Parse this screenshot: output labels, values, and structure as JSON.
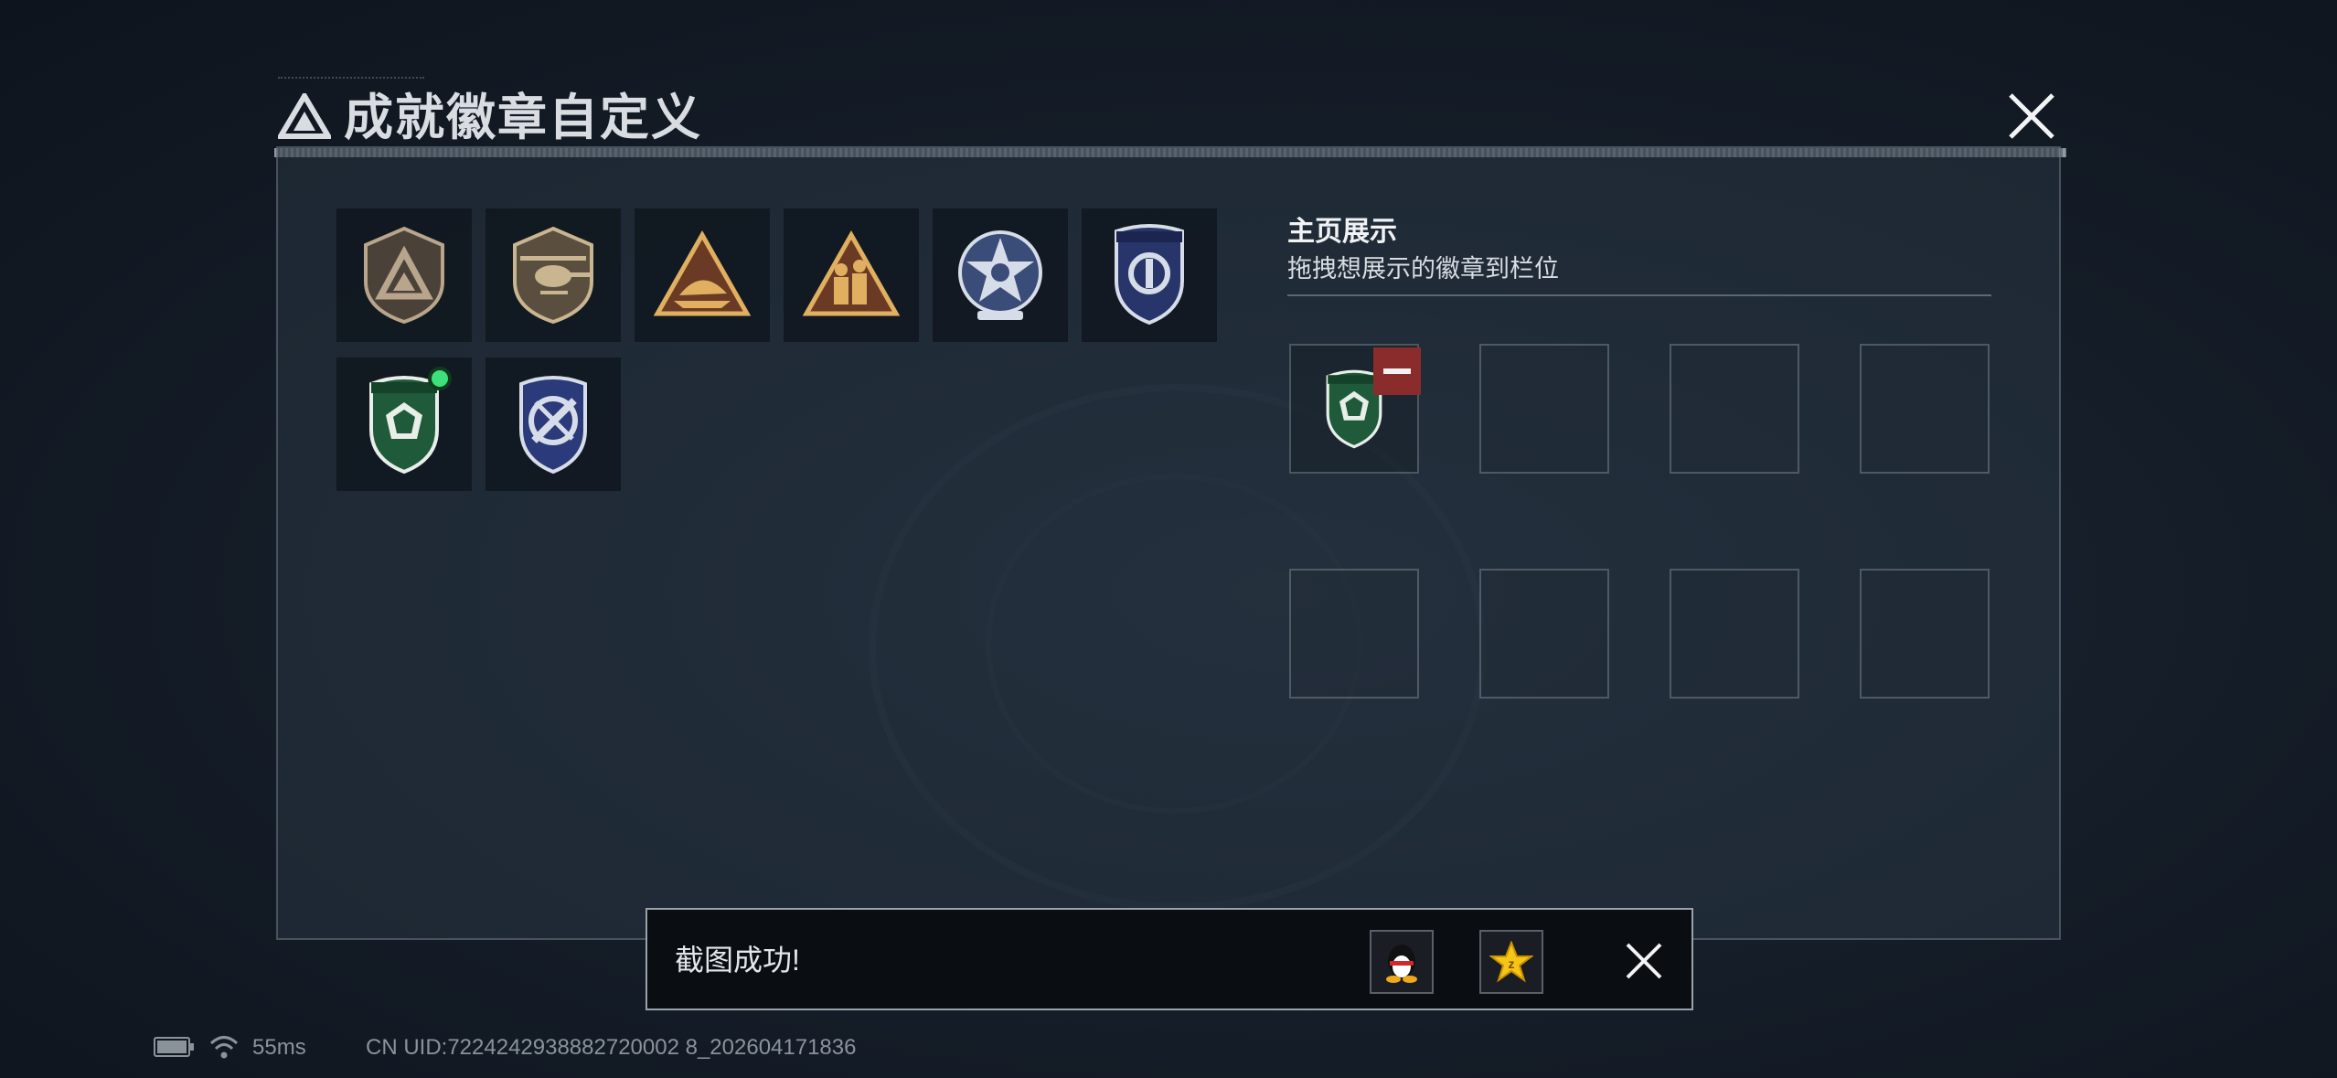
{
  "header": {
    "title": "成就徽章自定义",
    "logo_icon": "triangle-logo-icon",
    "close_icon": "close-icon"
  },
  "badges": [
    {
      "id": "badge-1",
      "icon": "triangle-shield-badge-icon",
      "colors": [
        "#4a4238",
        "#b8a58c"
      ]
    },
    {
      "id": "badge-2",
      "icon": "helicopter-badge-icon",
      "colors": [
        "#5a4f3f",
        "#c9b590"
      ]
    },
    {
      "id": "badge-3",
      "icon": "sailing-ship-badge-icon",
      "colors": [
        "#6b3a24",
        "#e0b060"
      ]
    },
    {
      "id": "badge-4",
      "icon": "soldiers-badge-icon",
      "colors": [
        "#6b3a24",
        "#e0b060"
      ]
    },
    {
      "id": "badge-5",
      "icon": "star-emblem-badge-icon",
      "colors": [
        "#3a4c78",
        "#d6dde8"
      ]
    },
    {
      "id": "badge-6",
      "icon": "blue-wreath-shield-badge-icon",
      "colors": [
        "#27356a",
        "#d6dde8"
      ]
    },
    {
      "id": "badge-7",
      "icon": "green-gem-shield-badge-icon",
      "colors": [
        "#1f5a3a",
        "#e8eee8"
      ],
      "new": true
    },
    {
      "id": "badge-8",
      "icon": "crossed-tools-shield-badge-icon",
      "colors": [
        "#2a3a7a",
        "#d6dde8"
      ]
    }
  ],
  "showcase": {
    "title": "主页展示",
    "subtitle": "拖拽想展示的徽章到栏位",
    "slots": [
      {
        "badge": "green-gem-shield-badge-icon",
        "removable": true
      },
      {
        "badge": null
      },
      {
        "badge": null
      },
      {
        "badge": null
      },
      {
        "badge": null
      },
      {
        "badge": null
      },
      {
        "badge": null
      },
      {
        "badge": null
      }
    ]
  },
  "toast": {
    "text": "截图成功!",
    "share_qq_icon": "qq-penguin-icon",
    "share_qzone_icon": "qzone-star-icon",
    "close_icon": "close-icon"
  },
  "status": {
    "battery_icon": "battery-charging-icon",
    "wifi_icon": "wifi-icon",
    "ping": "55ms",
    "uid": "CN UID:7224242938882720002 8_202604171836"
  }
}
